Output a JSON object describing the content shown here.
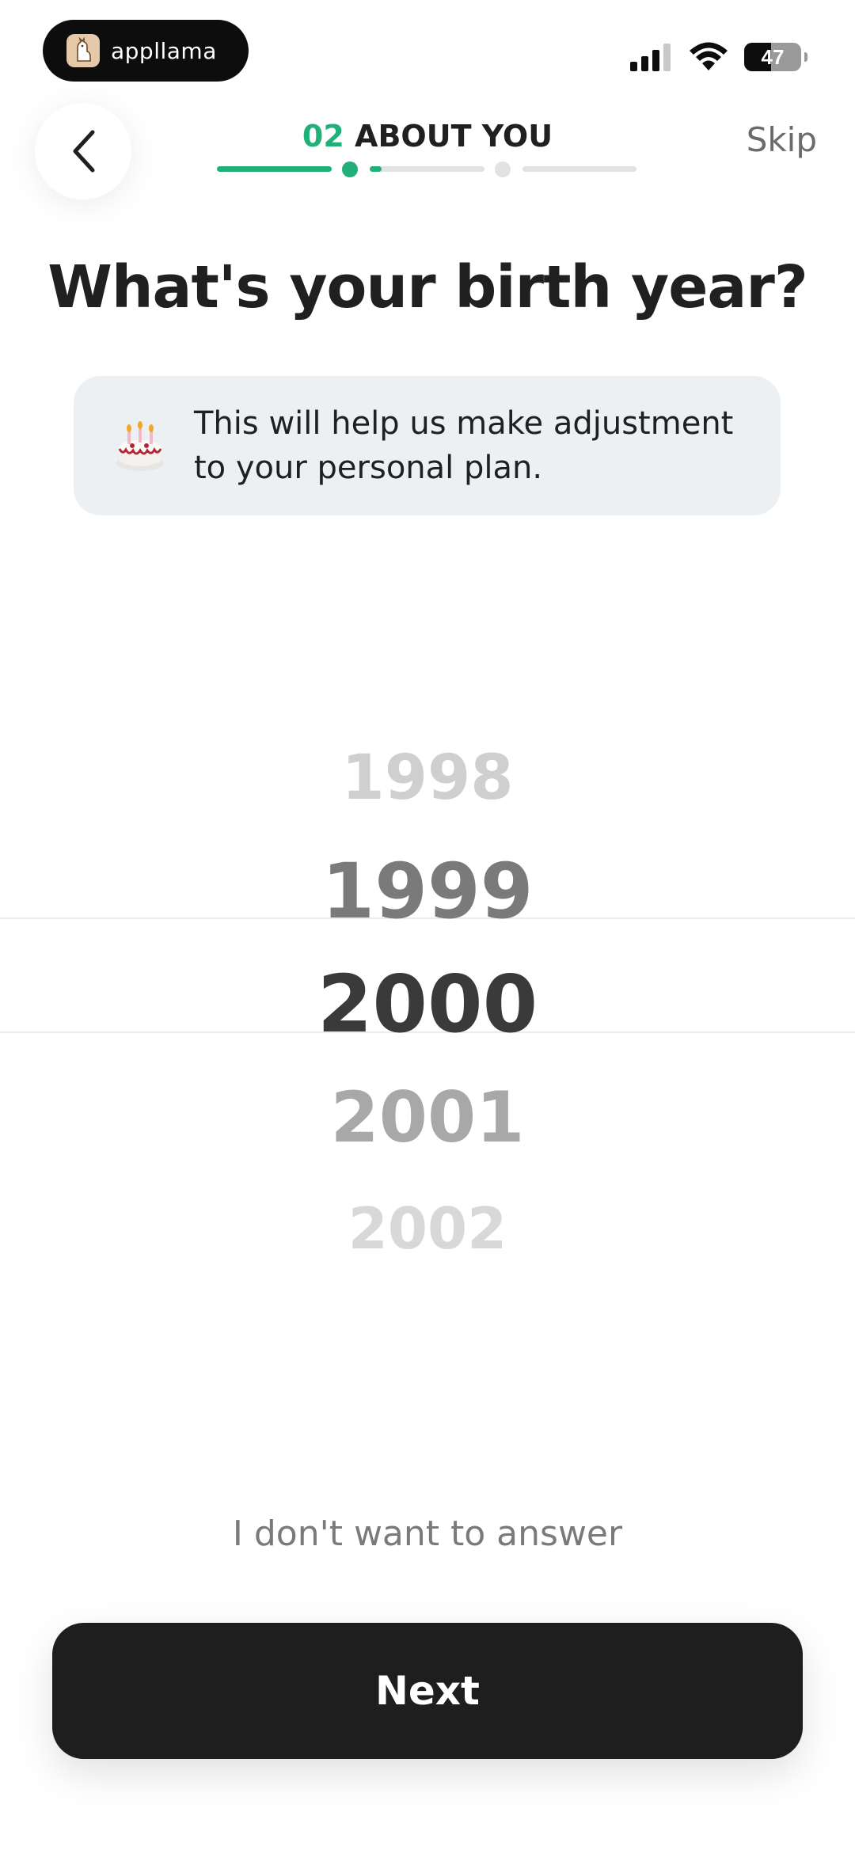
{
  "status_bar": {
    "app_badge_name": "appllama",
    "battery_level": 47,
    "battery_text": "47"
  },
  "header": {
    "step_number": "02",
    "step_label": "ABOUT YOU",
    "skip_label": "Skip",
    "progress": [
      1.0,
      0.1,
      0.0
    ]
  },
  "question": {
    "title": "What's your birth year?"
  },
  "info_card": {
    "icon": "birthday-cake-icon",
    "text": "This will help us make adjustment to your personal plan."
  },
  "picker": {
    "years": [
      "1998",
      "1999",
      "2000",
      "2001",
      "2002"
    ],
    "selected": "2000"
  },
  "footer": {
    "decline_label": "I don't want to answer",
    "next_label": "Next"
  },
  "colors": {
    "accent": "#20b078",
    "button": "#1e1e1e",
    "card": "#edf0f3"
  }
}
